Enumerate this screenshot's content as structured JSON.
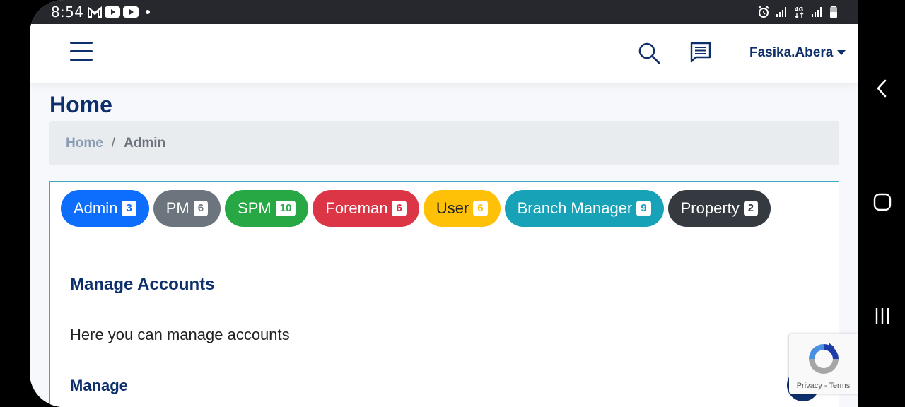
{
  "status_bar": {
    "time": "8:54",
    "icons": [
      "gmail-icon",
      "youtube-icon",
      "youtube-icon",
      "dot-icon"
    ],
    "right_icons": [
      "alarm-icon",
      "signal-icon",
      "4g-icon",
      "signal-icon",
      "battery-icon"
    ],
    "network_label": "4G"
  },
  "top_nav": {
    "user_name": "Fasika.Abera"
  },
  "page": {
    "title": "Home"
  },
  "breadcrumb": {
    "home": "Home",
    "separator": "/",
    "current": "Admin"
  },
  "roles": [
    {
      "label": "Admin",
      "count": "3",
      "bg": "#0d6efd",
      "fg": "#ffffff"
    },
    {
      "label": "PM",
      "count": "6",
      "bg": "#6c757d",
      "fg": "#ffffff"
    },
    {
      "label": "SPM",
      "count": "10",
      "bg": "#28a745",
      "fg": "#ffffff"
    },
    {
      "label": "Foreman",
      "count": "6",
      "bg": "#dc3545",
      "fg": "#ffffff"
    },
    {
      "label": "User",
      "count": "6",
      "bg": "#ffc107",
      "fg": "#212529"
    },
    {
      "label": "Branch Manager",
      "count": "9",
      "bg": "#17a2b8",
      "fg": "#ffffff"
    },
    {
      "label": "Property",
      "count": "2",
      "bg": "#343a40",
      "fg": "#ffffff"
    }
  ],
  "content": {
    "heading": "Manage Accounts",
    "description": "Here you can manage accounts",
    "subheading": "Manage"
  },
  "recaptcha": {
    "links": "Privacy - Terms"
  },
  "colors": {
    "brand_navy": "#0d2f6b",
    "card_border": "#41a9c0"
  }
}
